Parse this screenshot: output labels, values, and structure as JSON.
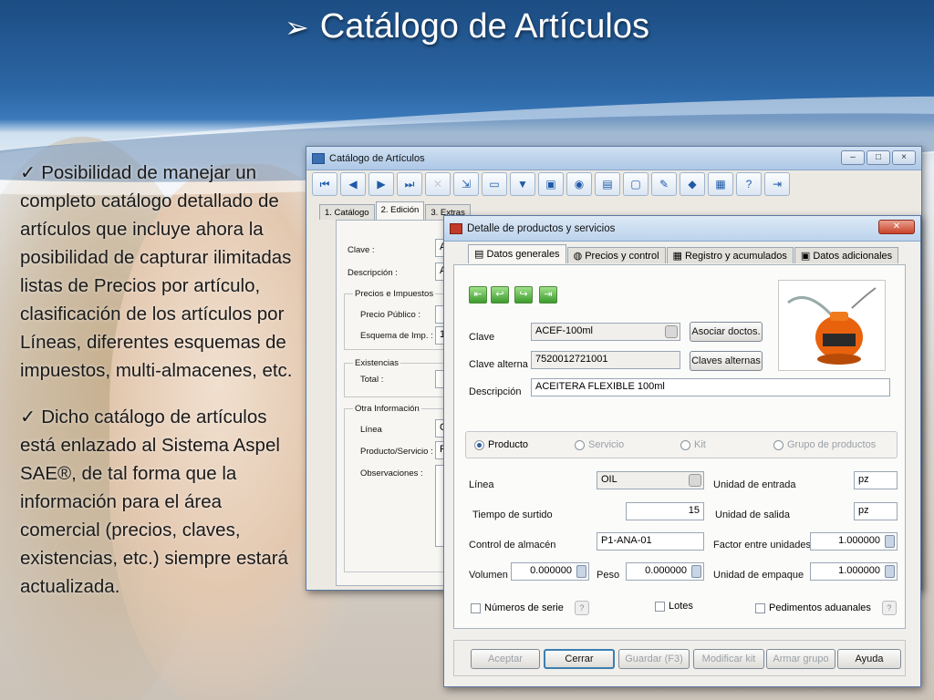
{
  "slide": {
    "title_marker": "➢",
    "title": "Catálogo de Artículos",
    "check_marker": "✓",
    "bullets": [
      "Posibilidad de manejar un completo catálogo detallado de artículos que incluye ahora la posibilidad de capturar ilimitadas listas de Precios por artículo, clasificación de los artículos por Líneas, diferentes esquemas de impuestos, multi-almacenes, etc.",
      "Dicho catálogo de artículos está enlazado al Sistema Aspel SAE®, de tal forma que la información para el área comercial (precios, claves, existencias, etc.) siempre estará actualizada."
    ]
  },
  "back_window": {
    "title": "Catálogo de Artículos",
    "tabs": [
      "1. Catálogo",
      "2. Edición",
      "3. Extras"
    ],
    "labels": {
      "clave": "Clave :",
      "descripcion": "Descripción :",
      "precios_group": "Precios e Impuestos",
      "precio_publico": "Precio Público :",
      "esquema": "Esquema de Imp. :",
      "existencias_group": "Existencias",
      "total": "Total :",
      "otra_group": "Otra Información",
      "linea": "Línea",
      "producto_servicio": "Producto/Servicio :",
      "observaciones": "Observaciones :"
    },
    "partial_values": {
      "clave": "A",
      "descripcion": "A",
      "esquema": "1",
      "linea": "O",
      "producto": "P"
    }
  },
  "front_window": {
    "title": "Detalle de productos y servicios",
    "tabs": [
      "Datos generales",
      "Precios y control",
      "Registro y acumulados",
      "Datos adicionales"
    ],
    "labels": {
      "clave": "Clave",
      "clave_alterna": "Clave alterna",
      "descripcion": "Descripción",
      "linea": "Línea",
      "tiempo_surtido": "Tiempo de surtido",
      "control_almacen": "Control de almacén",
      "volumen": "Volumen",
      "peso": "Peso",
      "unidad_entrada": "Unidad de entrada",
      "unidad_salida": "Unidad de salida",
      "factor": "Factor entre unidades",
      "unidad_empaque": "Unidad de empaque"
    },
    "values": {
      "clave": "ACEF-100ml",
      "clave_alterna": "7520012721001",
      "descripcion": "ACEITERA FLEXIBLE 100ml",
      "linea": "OIL",
      "tiempo_surtido": "15",
      "control_almacen": "P1-ANA-01",
      "volumen": "0.000000",
      "peso": "0.000000",
      "unidad_entrada": "pz",
      "unidad_salida": "pz",
      "factor": "1.000000",
      "unidad_empaque": "1.000000"
    },
    "buttons": {
      "asociar": "Asociar doctos.",
      "claves_alternas": "Claves alternas",
      "aceptar": "Aceptar",
      "cerrar": "Cerrar",
      "guardar": "Guardar (F3)",
      "modificar_kit": "Modificar kit",
      "armar_grupo": "Armar grupo",
      "ayuda": "Ayuda"
    },
    "tipo_options": [
      "Producto",
      "Servicio",
      "Kit",
      "Grupo de productos"
    ],
    "tipo_selected": "Producto",
    "checkboxes": [
      "Números de serie",
      "Lotes",
      "Pedimentos aduanales"
    ],
    "help_glyph": "?"
  },
  "colors": {
    "accent": "#2c67a6",
    "nav_green": "#3c9b2c"
  }
}
